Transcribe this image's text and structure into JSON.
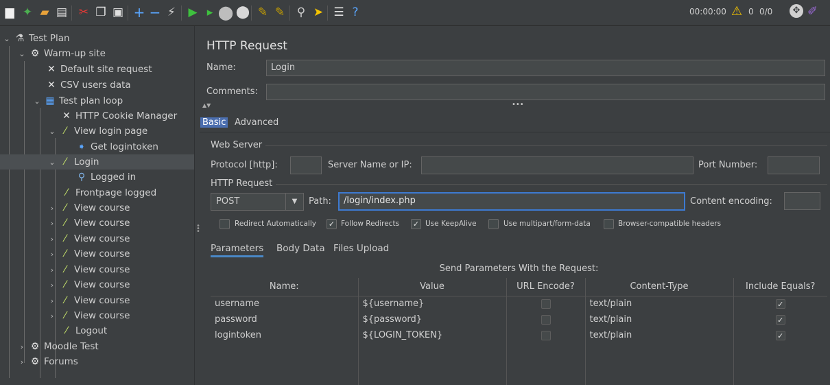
{
  "toolbar": {
    "timer": "00:00:00",
    "warnings": "0",
    "threads": "0/0"
  },
  "tree": {
    "items": [
      {
        "label": "Test Plan"
      },
      {
        "label": "Warm-up site"
      },
      {
        "label": "Default site request"
      },
      {
        "label": "CSV users data"
      },
      {
        "label": "Test plan loop"
      },
      {
        "label": "HTTP Cookie Manager"
      },
      {
        "label": "View login page"
      },
      {
        "label": "Get logintoken"
      },
      {
        "label": "Login"
      },
      {
        "label": "Logged in"
      },
      {
        "label": "Frontpage logged"
      },
      {
        "label": "View course"
      },
      {
        "label": "View course"
      },
      {
        "label": "View course"
      },
      {
        "label": "View course"
      },
      {
        "label": "View course"
      },
      {
        "label": "View course"
      },
      {
        "label": "View course"
      },
      {
        "label": "View course"
      },
      {
        "label": "Logout"
      },
      {
        "label": "Moodle Test"
      },
      {
        "label": "Forums"
      }
    ]
  },
  "panel": {
    "title": "HTTP Request",
    "name_label": "Name:",
    "name_value": "Login",
    "comments_label": "Comments:",
    "comments_value": "",
    "tabs": [
      "Basic",
      "Advanced"
    ],
    "web_server": {
      "title": "Web Server",
      "protocol_label": "Protocol [http]:",
      "protocol_value": "",
      "server_label": "Server Name or IP:",
      "server_value": "",
      "port_label": "Port Number:",
      "port_value": ""
    },
    "http_request": {
      "title": "HTTP Request",
      "method": "POST",
      "path_label": "Path:",
      "path_value": "/login/index.php",
      "encoding_label": "Content encoding:",
      "encoding_value": ""
    },
    "options": [
      {
        "label": "Redirect Automatically",
        "checked": false
      },
      {
        "label": "Follow Redirects",
        "checked": true
      },
      {
        "label": "Use KeepAlive",
        "checked": true
      },
      {
        "label": "Use multipart/form-data",
        "checked": false
      },
      {
        "label": "Browser-compatible headers",
        "checked": false
      }
    ],
    "subtabs": [
      "Parameters",
      "Body Data",
      "Files Upload"
    ],
    "send_label": "Send Parameters With the Request:",
    "columns": [
      "Name:",
      "Value",
      "URL Encode?",
      "Content-Type",
      "Include Equals?"
    ],
    "rows": [
      {
        "name": "username",
        "value": "${username}",
        "url_encode": false,
        "content_type": "text/plain",
        "include_equals": true
      },
      {
        "name": "password",
        "value": "${password}",
        "url_encode": false,
        "content_type": "text/plain",
        "include_equals": true
      },
      {
        "name": "logintoken",
        "value": "${LOGIN_TOKEN}",
        "url_encode": false,
        "content_type": "text/plain",
        "include_equals": true
      }
    ]
  },
  "colors": {
    "background": "#3c3f41",
    "selection": "#4b4f52",
    "focus": "#3d7ad1",
    "tab_active": "#4b6eaf"
  }
}
